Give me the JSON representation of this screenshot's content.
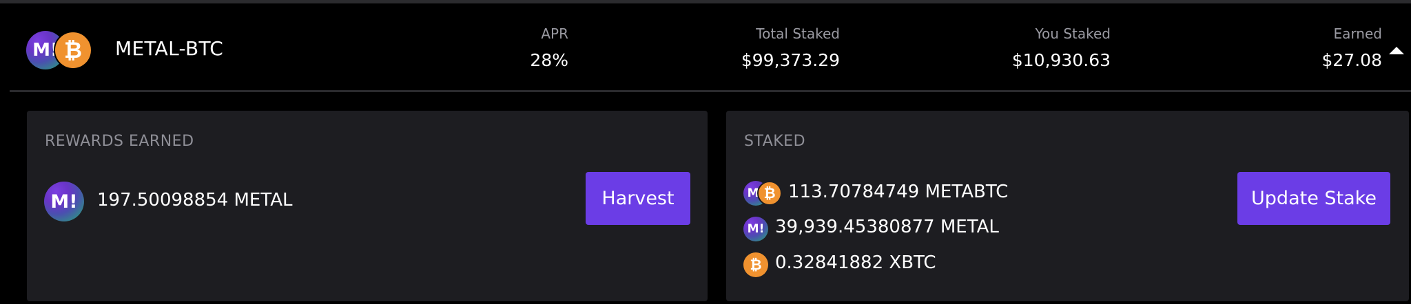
{
  "pool": {
    "name": "METAL-BTC",
    "stats": [
      {
        "label": "APR",
        "value": "28%"
      },
      {
        "label": "Total Staked",
        "value": "$99,373.29"
      },
      {
        "label": "You Staked",
        "value": "$10,930.63"
      },
      {
        "label": "Earned",
        "value": "$27.08"
      }
    ]
  },
  "icons": {
    "metal_glyph": "M!",
    "btc_glyph": "₿"
  },
  "rewards": {
    "title": "REWARDS EARNED",
    "amount": "197.50098854 METAL",
    "harvest_label": "Harvest"
  },
  "staked": {
    "title": "STAKED",
    "items": [
      {
        "amount": "113.70784749 METABTC"
      },
      {
        "amount": "39,939.45380877 METAL"
      },
      {
        "amount": "0.32841882 XBTC"
      }
    ],
    "update_label": "Update Stake"
  },
  "colors": {
    "accent": "#6b3de6",
    "card_bg": "#1d1d21",
    "btc": "#f0922f",
    "metal": "#6a35c8"
  }
}
